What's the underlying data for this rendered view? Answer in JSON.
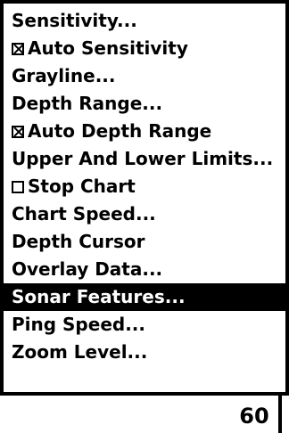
{
  "menu": {
    "items": [
      {
        "label": "Sensitivity...",
        "checkbox": null,
        "selected": false
      },
      {
        "label": "Auto Sensitivity",
        "checkbox": "checked",
        "selected": false
      },
      {
        "label": "Grayline...",
        "checkbox": null,
        "selected": false
      },
      {
        "label": "Depth Range...",
        "checkbox": null,
        "selected": false
      },
      {
        "label": "Auto Depth Range",
        "checkbox": "checked",
        "selected": false
      },
      {
        "label": "Upper And Lower Limits...",
        "checkbox": null,
        "selected": false
      },
      {
        "label": "Stop Chart",
        "checkbox": "unchecked",
        "selected": false
      },
      {
        "label": "Chart Speed...",
        "checkbox": null,
        "selected": false
      },
      {
        "label": "Depth Cursor",
        "checkbox": null,
        "selected": false
      },
      {
        "label": "Overlay Data...",
        "checkbox": null,
        "selected": false
      },
      {
        "label": "Sonar Features...",
        "checkbox": null,
        "selected": true
      },
      {
        "label": "Ping Speed...",
        "checkbox": null,
        "selected": false
      },
      {
        "label": "Zoom Level...",
        "checkbox": null,
        "selected": false
      }
    ]
  },
  "status": {
    "value": "60"
  },
  "colors": {
    "foreground": "#000000",
    "background": "#ffffff",
    "selection": "#000000"
  }
}
